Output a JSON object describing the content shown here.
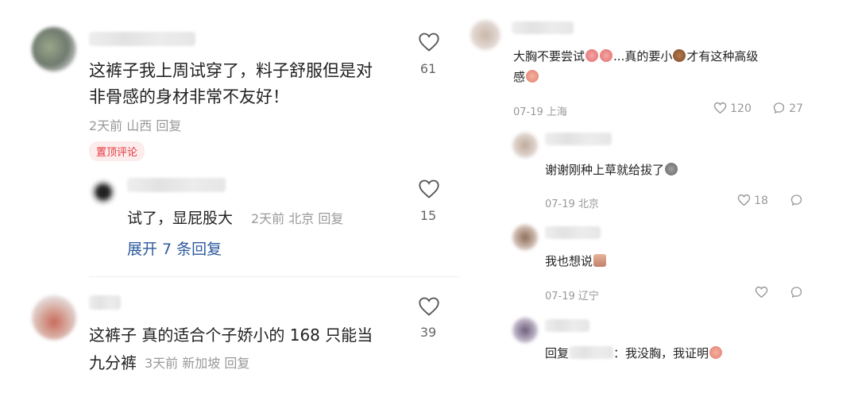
{
  "left": {
    "comment1": {
      "text_line1": "这裤子我上周试穿了，料子舒服但是对",
      "text_line2": "非骨感的身材非常不友好！",
      "meta": "2天前 山西 回复",
      "pin_label": "置顶评论",
      "likes": "61"
    },
    "reply1": {
      "text": "试了，显屁股大",
      "meta": "2天前 北京 回复",
      "likes": "15"
    },
    "expand_label": "展开 7 条回复",
    "comment2": {
      "text_line1": "这裤子 真的适合个子娇小的 168 只能当",
      "text_line2": "九分裤",
      "meta": "3天前 新加坡 回复",
      "likes": "39"
    }
  },
  "right": {
    "comment1": {
      "text_part1": "大胸不要尝试",
      "text_part2": "...真的要小",
      "text_part3": "才有这种高级",
      "text_line2": "感",
      "date_loc": "07-19 上海",
      "likes": "120",
      "replies": "27"
    },
    "reply1": {
      "text": "谢谢刚种上草就给拔了",
      "date_loc": "07-19 北京",
      "likes": "18"
    },
    "reply2": {
      "text": "我也想说",
      "date_loc": "07-19 辽宁"
    },
    "reply3": {
      "prefix": "回复",
      "text": "：我没胸，我证明"
    }
  },
  "colors": {
    "link_blue": "#2d5a9e",
    "pin_red": "#e5363f",
    "meta_gray": "#999999"
  }
}
